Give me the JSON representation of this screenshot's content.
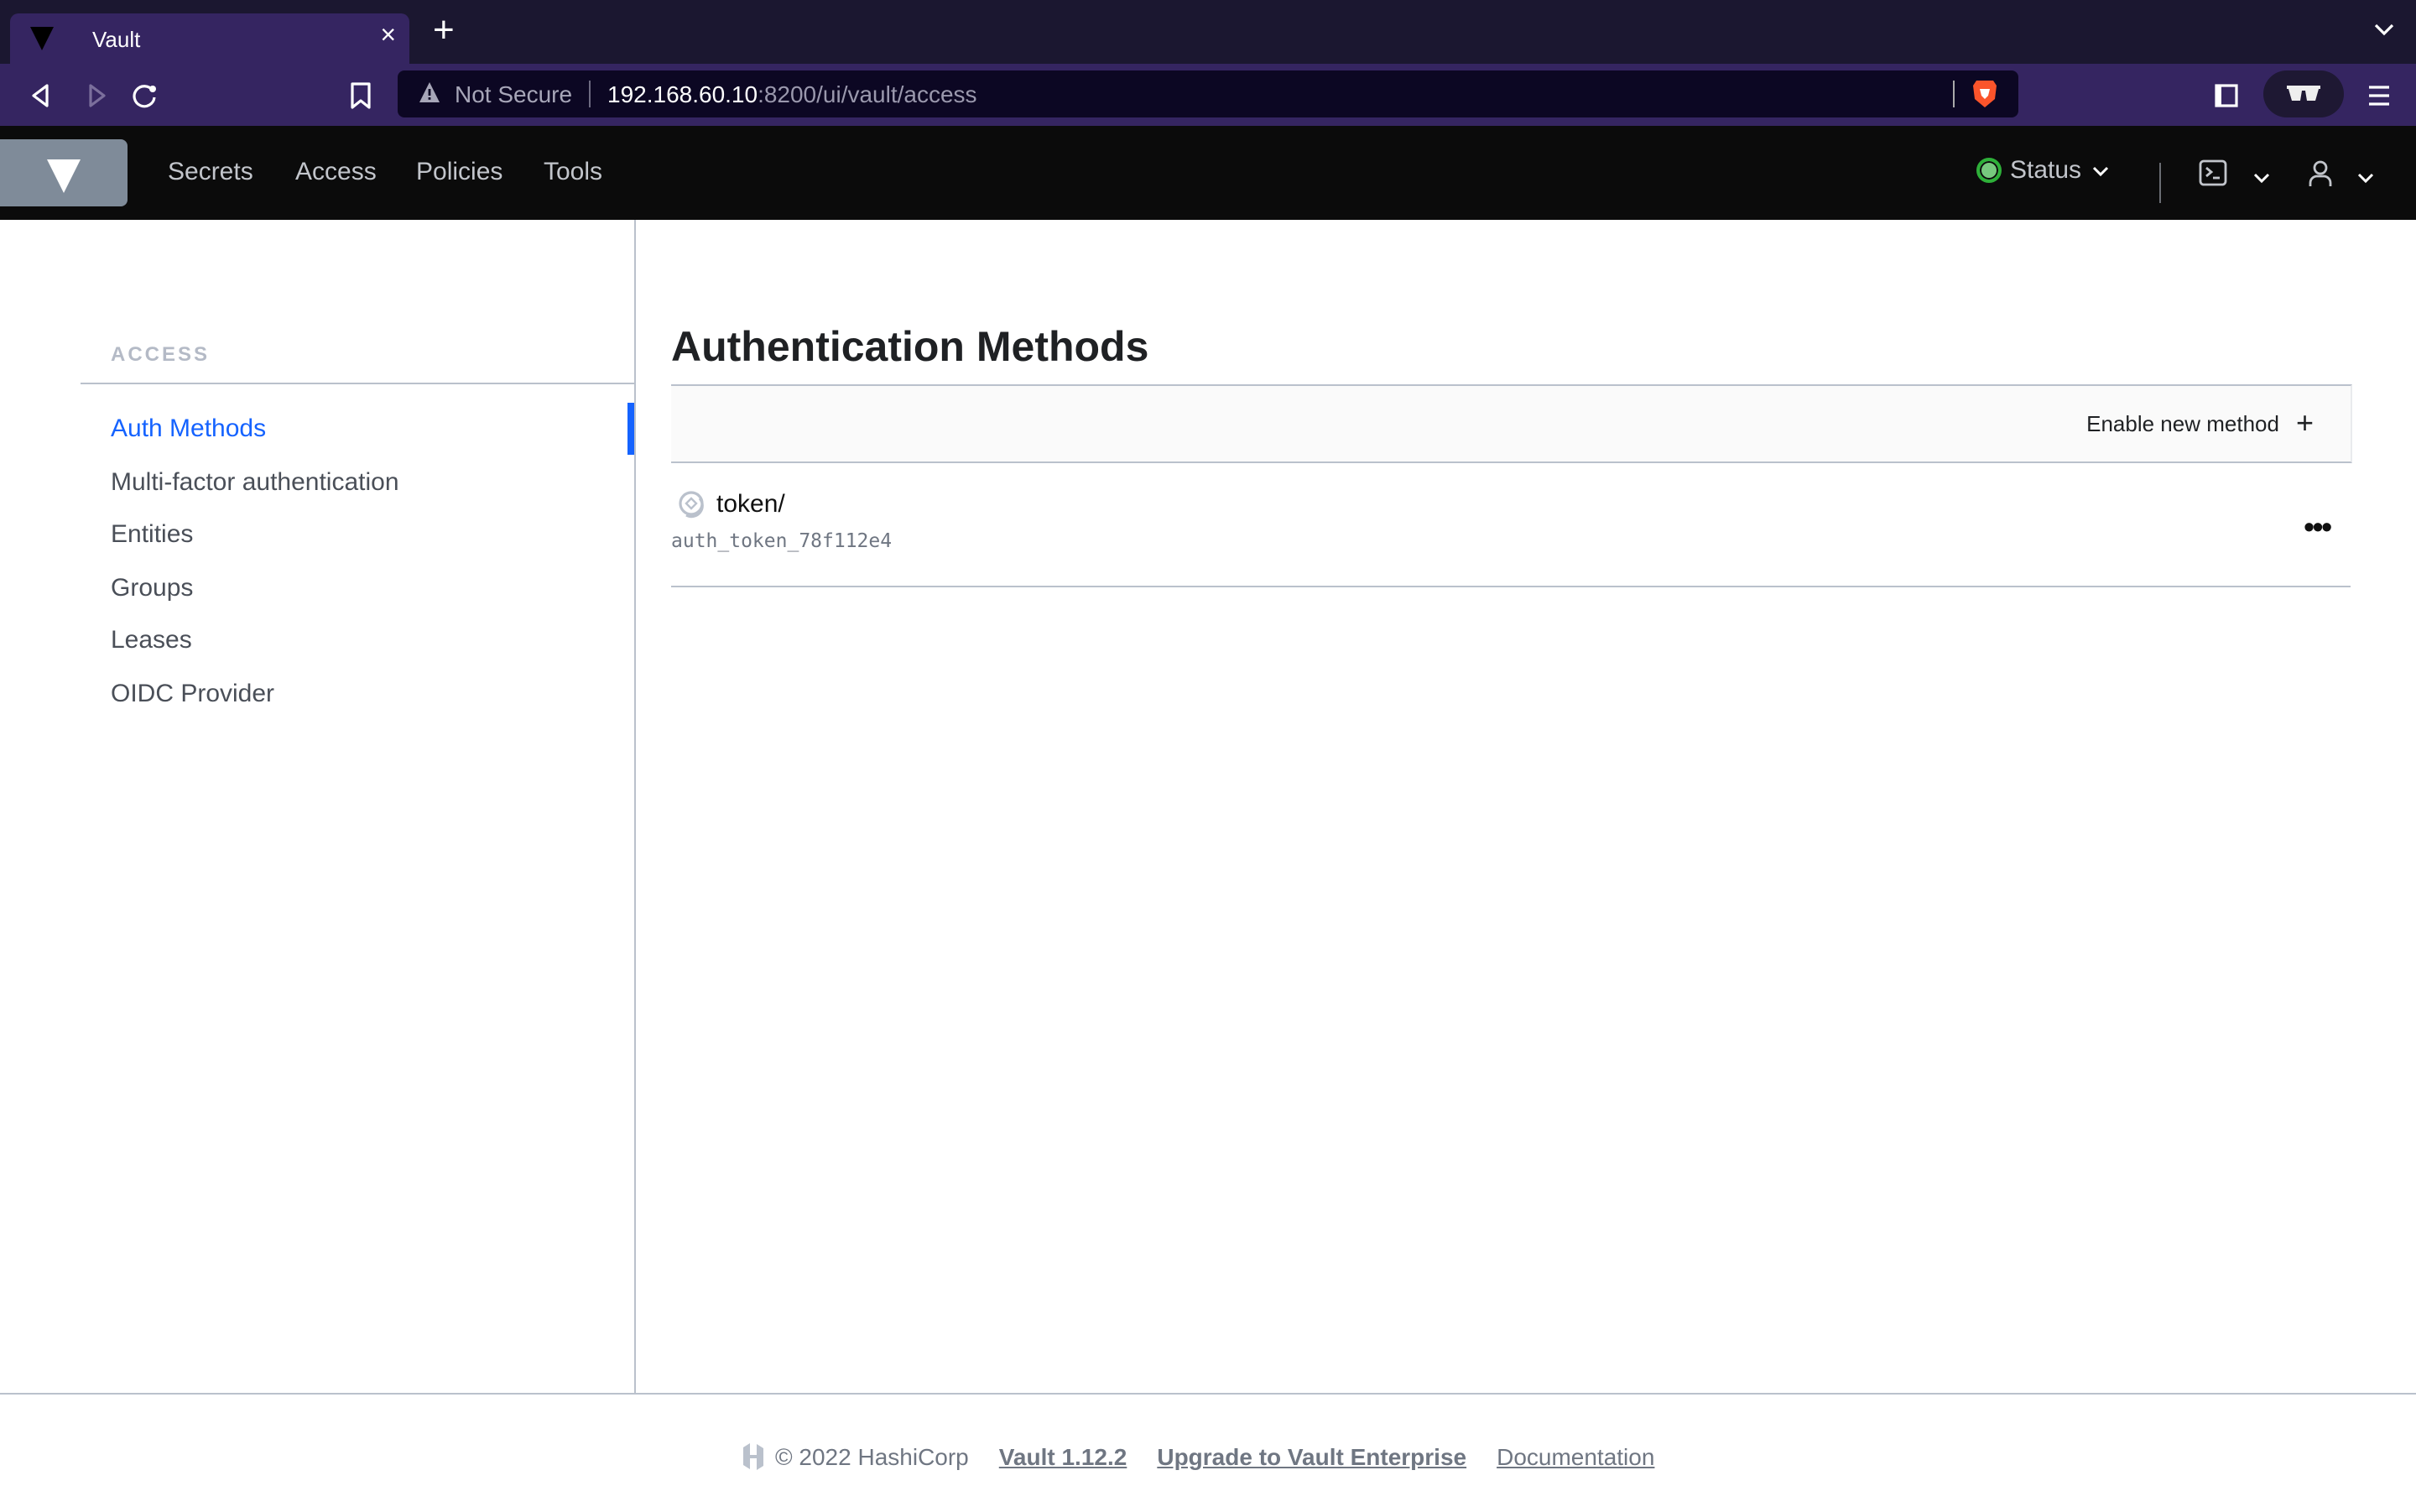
{
  "browser": {
    "tab_title": "Vault",
    "new_tab_label": "+",
    "close_tab_label": "×",
    "security_label": "Not Secure",
    "url_host": "192.168.60.10",
    "url_rest": ":8200/ui/vault/access"
  },
  "header": {
    "nav": [
      {
        "label": "Secrets"
      },
      {
        "label": "Access"
      },
      {
        "label": "Policies"
      },
      {
        "label": "Tools"
      }
    ],
    "status_label": "Status",
    "status_color": "#77c97e"
  },
  "sidebar": {
    "heading": "ACCESS",
    "items": [
      {
        "label": "Auth Methods",
        "active": true
      },
      {
        "label": "Multi-factor authentication"
      },
      {
        "label": "Entities"
      },
      {
        "label": "Groups"
      },
      {
        "label": "Leases"
      },
      {
        "label": "OIDC Provider"
      }
    ],
    "accent_color": "#1563ff"
  },
  "main": {
    "title": "Authentication Methods",
    "enable_button_label": "Enable new method",
    "methods": [
      {
        "path": "token/",
        "accessor": "auth_token_78f112e4",
        "icon": "token-icon"
      }
    ]
  },
  "footer": {
    "copyright": "© 2022 HashiCorp",
    "version_link": "Vault 1.12.2",
    "upgrade_link": "Upgrade to Vault Enterprise",
    "docs_link": "Documentation"
  }
}
